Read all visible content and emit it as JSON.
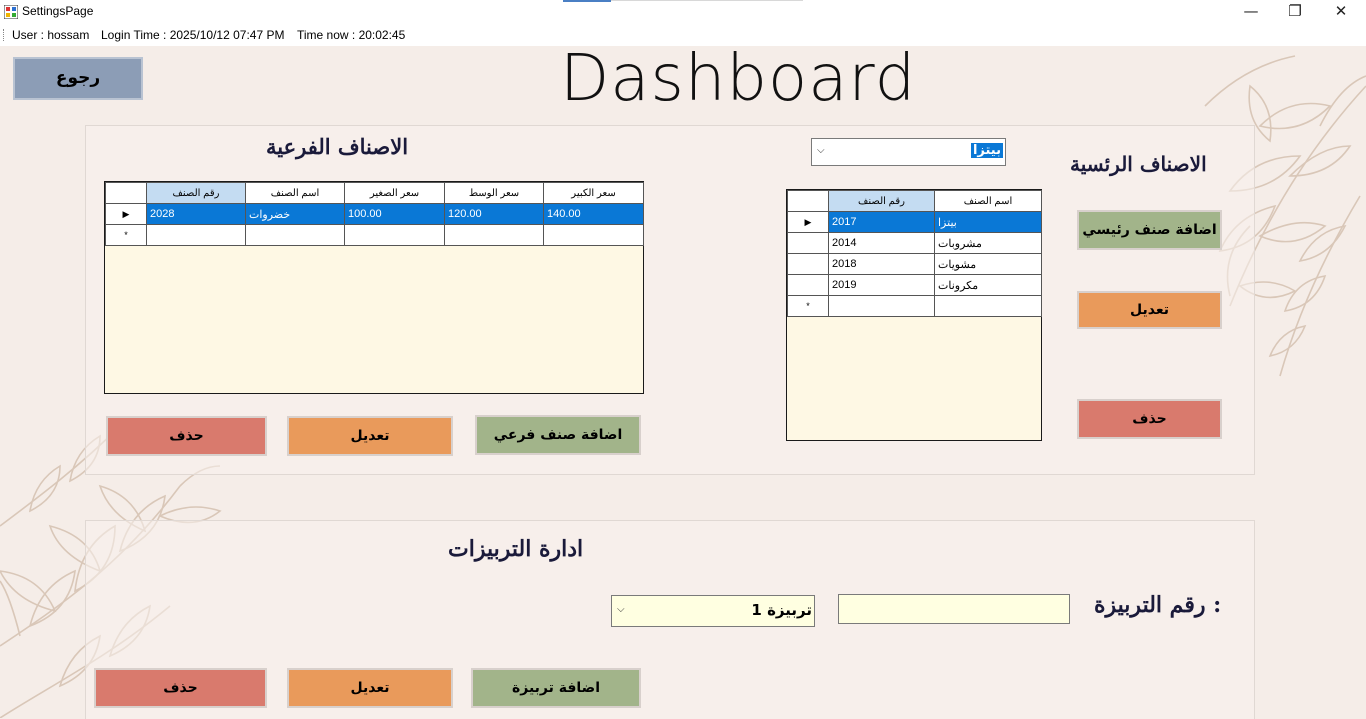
{
  "window": {
    "title": "SettingsPage",
    "minimize_glyph": "—",
    "restore_glyph": "❐",
    "close_glyph": "✕"
  },
  "status": {
    "user": "User : hossam",
    "login_time": "Login Time :  2025/10/12 07:47 PM",
    "time_now": "Time now  :  20:02:45"
  },
  "header": {
    "back_label": "رجوع",
    "title": "Dashboard"
  },
  "sub_categories": {
    "heading": "الاصناف الفرعية",
    "columns": [
      "رقم الصنف",
      "اسم الصنف",
      "سعر الصغير",
      "سعر الوسط",
      "سعر الكبير"
    ],
    "rows": [
      [
        "2028",
        "خضروات",
        "100.00",
        "120.00",
        "140.00"
      ]
    ],
    "new_row_glyph": "*",
    "selected_row_glyph": "▶",
    "delete_label": "حذف",
    "edit_label": "تعديل",
    "add_label": "اضافة صنف فرعي"
  },
  "main_categories": {
    "heading": "الاصناف الرئسية",
    "selected_value": "بيتزا",
    "columns": [
      "رقم الصنف",
      "اسم الصنف"
    ],
    "rows": [
      [
        "2017",
        "بيتزا"
      ],
      [
        "2014",
        "مشروبات"
      ],
      [
        "2018",
        "مشويات"
      ],
      [
        "2019",
        "مكرونات"
      ]
    ],
    "new_row_glyph": "*",
    "selected_row_glyph": "▶",
    "add_label": "اضافة صنف رئيسي",
    "edit_label": "تعديل",
    "delete_label": "حذف"
  },
  "tables": {
    "heading": "ادارة التربيزات",
    "table_number_label": "رقم التربيزة :",
    "selected_table": "تربيزة 1",
    "table_number_value": "",
    "delete_label": "حذف",
    "edit_label": "تعديل",
    "add_label": "اضافة تربيزة"
  },
  "colors": {
    "background": "#f5ede8",
    "green_button": "#a2b48a",
    "orange_button": "#e99a5b",
    "red_button": "#d97a6d",
    "back_button": "#8c9db6",
    "grid_background": "#fef8e4",
    "selection": "#0a78d6"
  },
  "icons": {
    "app": "app-icon",
    "combo_arrow": "chevron-down-icon"
  }
}
